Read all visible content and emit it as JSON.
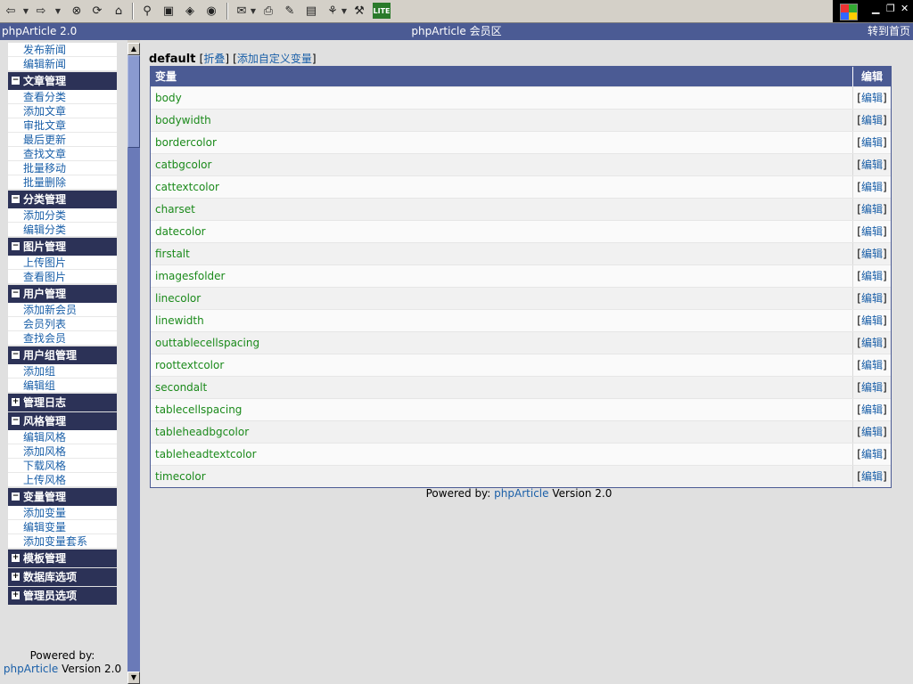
{
  "header": {
    "left_title": "phpArticle 2.0",
    "center_title": "phpArticle 会员区",
    "right_link": "转到首页"
  },
  "toolbar": {
    "icons": [
      "back-icon",
      "forward-icon",
      "stop-icon",
      "refresh-icon",
      "home-icon",
      "search-icon",
      "favorites-icon",
      "history-icon",
      "media-icon",
      "edit-icon",
      "print-icon",
      "mail-icon",
      "document-icon",
      "messenger-icon",
      "tools-icon",
      "lite-icon"
    ]
  },
  "sidebar": {
    "groups": [
      {
        "title": "",
        "expanded": true,
        "items": [
          "发布新闻",
          "编辑新闻"
        ]
      },
      {
        "title": "文章管理",
        "expanded": true,
        "items": [
          "查看分类",
          "添加文章",
          "审批文章",
          "最后更新",
          "查找文章",
          "批量移动",
          "批量删除"
        ]
      },
      {
        "title": "分类管理",
        "expanded": true,
        "items": [
          "添加分类",
          "编辑分类"
        ]
      },
      {
        "title": "图片管理",
        "expanded": true,
        "items": [
          "上传图片",
          "查看图片"
        ]
      },
      {
        "title": "用户管理",
        "expanded": true,
        "items": [
          "添加新会员",
          "会员列表",
          "查找会员"
        ]
      },
      {
        "title": "用户组管理",
        "expanded": true,
        "items": [
          "添加组",
          "编辑组"
        ]
      },
      {
        "title": "管理日志",
        "expanded": false,
        "items": []
      },
      {
        "title": "风格管理",
        "expanded": true,
        "items": [
          "编辑风格",
          "添加风格",
          "下载风格",
          "上传风格"
        ]
      },
      {
        "title": "变量管理",
        "expanded": true,
        "items": [
          "添加变量",
          "编辑变量",
          "添加变量套系"
        ]
      },
      {
        "title": "模板管理",
        "expanded": false,
        "items": []
      },
      {
        "title": "数据库选项",
        "expanded": false,
        "items": []
      },
      {
        "title": "管理员选项",
        "expanded": false,
        "items": []
      }
    ],
    "footer": {
      "powered_by": "Powered by:",
      "brand": "phpArticle",
      "version": "Version 2.0"
    }
  },
  "main": {
    "set_name": "default",
    "collapse_label": "折叠",
    "add_custom_label": "添加自定义变量",
    "table": {
      "headers": [
        "变量",
        "编辑"
      ],
      "edit_label": "编辑",
      "rows": [
        "body",
        "bodywidth",
        "bordercolor",
        "catbgcolor",
        "cattextcolor",
        "charset",
        "datecolor",
        "firstalt",
        "imagesfolder",
        "linecolor",
        "linewidth",
        "outtablecellspacing",
        "roottextcolor",
        "secondalt",
        "tablecellspacing",
        "tableheadbgcolor",
        "tableheadtextcolor",
        "timecolor"
      ]
    },
    "footer": {
      "powered_by": "Powered by:",
      "brand": "phpArticle",
      "version": "Version 2.0"
    }
  },
  "colors": {
    "header_bg": "#4b5b94",
    "sidebar_head_bg": "#2c3257",
    "link": "#1a5fa8",
    "var_name": "#1b8a1b"
  }
}
